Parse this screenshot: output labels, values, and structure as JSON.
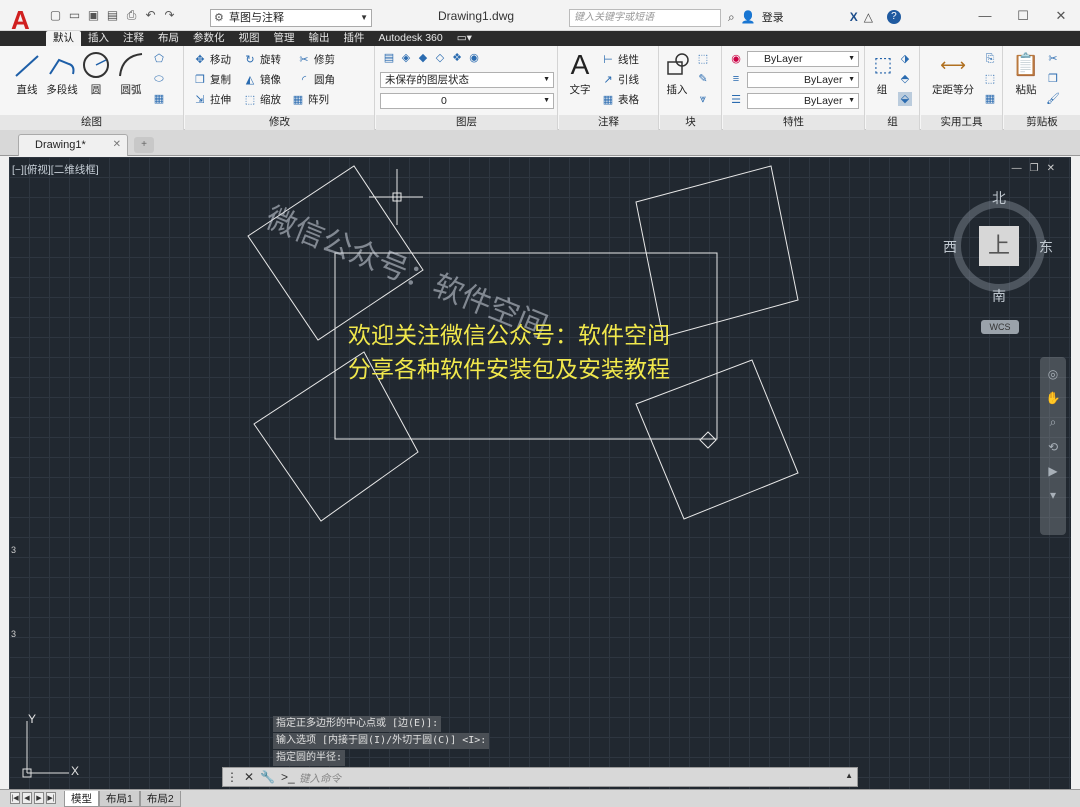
{
  "title_bar": {
    "document_title": "Drawing1.dwg",
    "workspace": "草图与注释",
    "search_placeholder": "键入关键字或短语",
    "login_label": "登录",
    "help_label": "?"
  },
  "ribbon_tabs": [
    "默认",
    "插入",
    "注释",
    "布局",
    "参数化",
    "视图",
    "管理",
    "输出",
    "插件",
    "Autodesk 360"
  ],
  "ribbon": {
    "draw": {
      "title": "绘图",
      "tools": [
        "直线",
        "多段线",
        "圆",
        "圆弧"
      ]
    },
    "modify": {
      "title": "修改",
      "tools": [
        "移动",
        "旋转",
        "修剪",
        "复制",
        "镜像",
        "圆角",
        "拉伸",
        "缩放",
        "阵列"
      ]
    },
    "layers": {
      "title": "图层",
      "layer_state": "未保存的图层状态",
      "current_layer": "0"
    },
    "annotation": {
      "title": "注释",
      "text": "文字",
      "dim": "线性",
      "leader": "引线",
      "table": "表格"
    },
    "block": {
      "title": "块",
      "insert": "插入"
    },
    "properties": {
      "title": "特性",
      "color": "ByLayer",
      "linetype": "ByLayer",
      "lineweight": "ByLayer"
    },
    "groups": {
      "title": "组",
      "group": "组"
    },
    "utilities": {
      "title": "实用工具",
      "measure": "定距等分"
    },
    "clipboard": {
      "title": "剪贴板",
      "paste": "粘贴"
    }
  },
  "doc_tab": {
    "label": "Drawing1*"
  },
  "viewport": {
    "label": "[−][俯视][二维线框]",
    "overlay_line1": "欢迎关注微信公众号：软件空间",
    "overlay_line2": "分享各种软件安装包及安装教程",
    "watermark": "微信公众号：软件空间",
    "viewcube": {
      "face": "上",
      "north": "北",
      "south": "南",
      "west": "西",
      "east": "东",
      "wcs": "WCS"
    },
    "left_marks": [
      "3",
      "3"
    ]
  },
  "command": {
    "history": [
      "指定正多边形的中心点或 [边(E)]:",
      "输入选项 [内接于圆(I)/外切于圆(C)] <I>:",
      "指定圆的半径:"
    ],
    "input_placeholder": "键入命令"
  },
  "layout_tabs": [
    "模型",
    "布局1",
    "布局2"
  ],
  "colors": {
    "canvas": "#212830",
    "overlay_text": "#f1e84c",
    "ribbon_tab_bar": "#2b2b2b",
    "app_red": "#d02020"
  }
}
